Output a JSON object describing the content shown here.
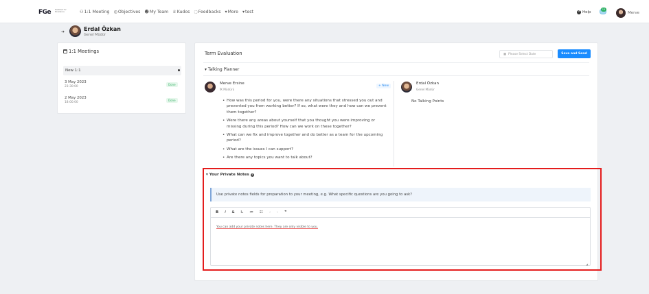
{
  "app": {
    "logo_text": "FGe",
    "logo_subtext": "Feedback for Excellence"
  },
  "nav": {
    "items": [
      {
        "icon": "chat-icon",
        "glyph": "⚇",
        "label": "1:1 Meeting"
      },
      {
        "icon": "target-icon",
        "glyph": "◎",
        "label": "Objectives"
      },
      {
        "icon": "team-icon",
        "glyph": "☻",
        "label": "My Team"
      },
      {
        "icon": "trophy-icon",
        "glyph": "♕",
        "label": "Kudos"
      },
      {
        "icon": "speech-icon",
        "glyph": "◌",
        "label": "Feedbacks"
      },
      {
        "icon": "chevron-down-icon",
        "glyph": "▾",
        "label": "More"
      },
      {
        "icon": "chevron-down-icon",
        "glyph": "▾",
        "label": "test"
      }
    ],
    "help_label": "Help",
    "notification_count": "15",
    "user_name": "Merve"
  },
  "profile": {
    "name": "Erdal Özkan",
    "role": "Genel Müdür"
  },
  "meetings": {
    "title": "1:1 Meetings",
    "new_label": "New 1:1",
    "rows": [
      {
        "date": "3 May 2023",
        "time": "23:30:00",
        "status": "Done"
      },
      {
        "date": "2 May 2023",
        "time": "18:00:00",
        "status": "Done"
      }
    ]
  },
  "term": {
    "title": "Term Evaluation",
    "date_placeholder": "Please Select Date",
    "save_button": "Save and Send"
  },
  "talking_planner": {
    "title": "Talking Planner",
    "left": {
      "name": "Merve Ersine",
      "role": "İK Müdürü",
      "new_label": "+ New",
      "questions": [
        "How was this period for you, were there any situations that stressed you out and prevented you from working better? If so, what were they and how can we prevent them together?",
        "Were there any areas about yourself that you thought you were improving or missing during this period? How can we work on these together?",
        "What can we fix and improve together and do better as a team for the upcoming period?",
        "What are the issues I can support?",
        "Are there any topics you want to talk about?"
      ]
    },
    "right": {
      "name": "Erdal Özkan",
      "role": "Genel Müdür",
      "empty_text": "No Talking Points"
    }
  },
  "private_notes": {
    "title": "Your Private Notes",
    "hint": "Use private notes fields for preparation to your meeting, e.g. What specific questions are you going to ask?",
    "toolbar": [
      "B",
      "I",
      "S",
      "Iₓ",
      "≔",
      "☷",
      "‹",
      "›",
      "❞"
    ],
    "editor_text": "You can add your private notes here. They are only visible to you."
  }
}
